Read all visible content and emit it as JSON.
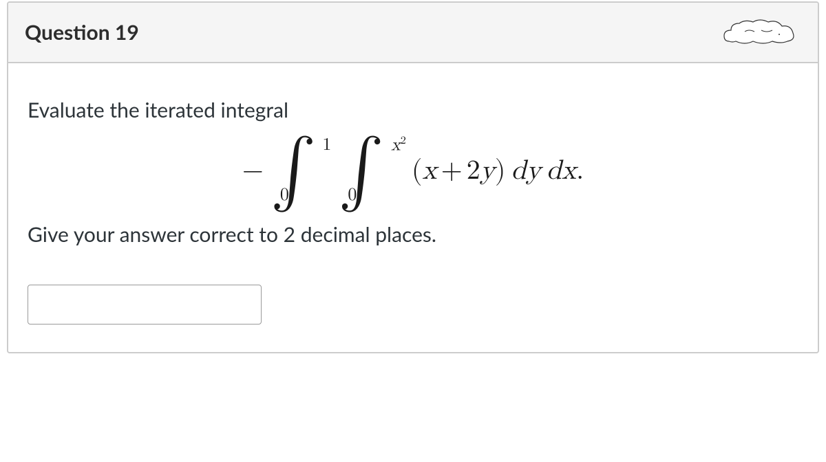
{
  "question": {
    "title": "Question 19",
    "prompt": "Evaluate the iterated integral",
    "instruction": "Give your answer correct to 2 decimal places.",
    "equation": {
      "leading_sign": "−",
      "outer_integral": {
        "symbol": "∫",
        "upper": "1",
        "lower": "0"
      },
      "inner_integral": {
        "symbol": "∫",
        "upper_base": "x",
        "upper_exp": "2",
        "lower": "0"
      },
      "integrand": {
        "open": "(",
        "term1_var": "x",
        "plus": "+",
        "term2_coef": "2",
        "term2_var": "y",
        "close": ")",
        "d1": "dy",
        "d2": "dx",
        "period": "."
      }
    },
    "answer_value": ""
  }
}
